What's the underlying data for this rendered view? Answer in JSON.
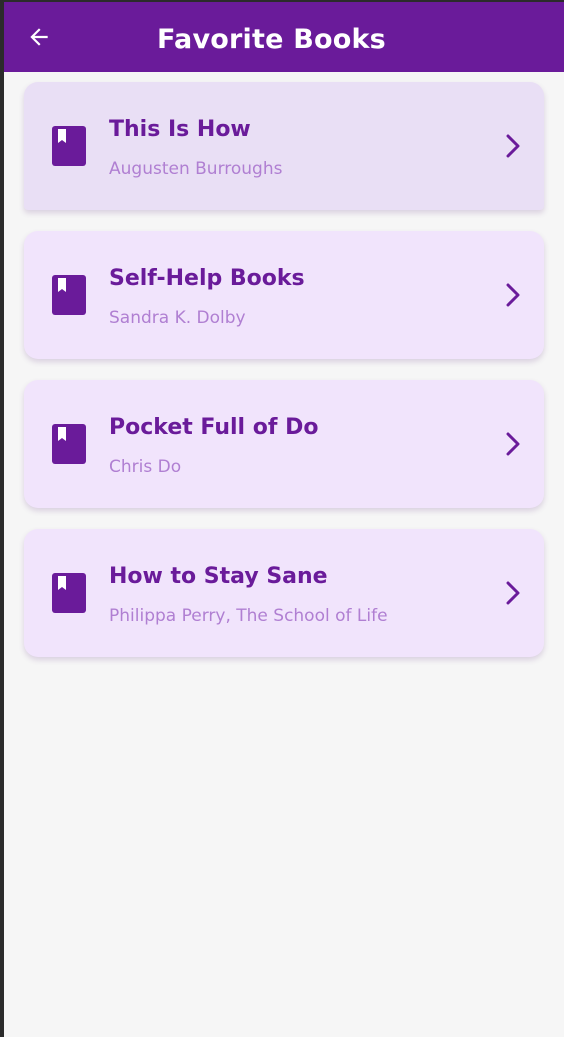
{
  "appbar": {
    "title": "Favorite Books",
    "back_icon": "arrow-left-icon",
    "color": "#6a1b9a"
  },
  "books": [
    {
      "title": "This Is How",
      "author": "Augusten Burroughs",
      "icon": "book-icon"
    },
    {
      "title": "Self-Help Books",
      "author": "Sandra K. Dolby",
      "icon": "book-icon"
    },
    {
      "title": "Pocket Full of Do",
      "author": "Chris Do",
      "icon": "book-icon"
    },
    {
      "title": "How to Stay Sane",
      "author": "Philippa Perry, The School of Life",
      "icon": "book-icon"
    }
  ],
  "colors": {
    "accent": "#6a1b9a",
    "card_bg": "#f1e4fc",
    "card_bg_pressed": "#e9dff5",
    "subtitle": "#b07fd2",
    "page_bg": "#f6f6f6"
  }
}
